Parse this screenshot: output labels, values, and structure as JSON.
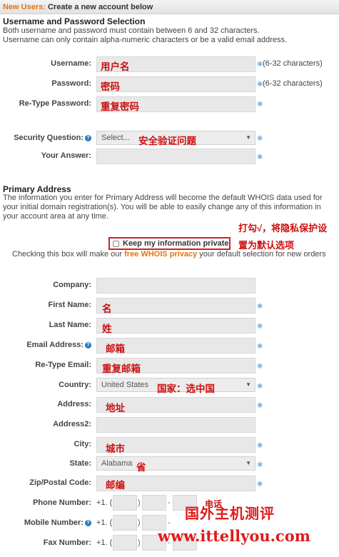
{
  "header": {
    "highlight": "New Users:",
    "title": "Create a new account below"
  },
  "account": {
    "title": "Username and Password Selection",
    "desc1": "Both username and password must contain between 6 and 32 characters.",
    "desc2": "Username can only contain alpha-numeric characters or be a valid email address.",
    "username_label": "Username:",
    "username_value": "用户名",
    "username_hint": "(6-32 characters)",
    "password_label": "Password:",
    "password_value": "密码",
    "password_hint": "(6-32 characters)",
    "retype_label": "Re-Type Password:",
    "retype_value": "重复密码",
    "question_label": "Security Question:",
    "question_value": "Select...",
    "question_note": "安全验证问题",
    "answer_label": "Your Answer:"
  },
  "primary": {
    "title": "Primary Address",
    "desc": "The information you enter for Primary Address will become the default WHOIS data used for your initial domain registration(s). You will be able to easily change any of this information in your account area at any time.",
    "privacy_label": "Keep my information private",
    "privacy_note1": "打勾√，将隐私保护设",
    "privacy_note2": "置为默认选项",
    "privacy_desc_before": "Checking this box will make our ",
    "privacy_desc_link": "free WHOIS privacy",
    "privacy_desc_after": " your default selection for new orders"
  },
  "form": {
    "company_label": "Company:",
    "first_label": "First Name:",
    "first_value": "名",
    "last_label": "Last Name:",
    "last_value": "姓",
    "email_label": "Email Address:",
    "email_value": "邮箱",
    "retype_email_label": "Re-Type Email:",
    "retype_email_value": "重复邮箱",
    "country_label": "Country:",
    "country_value": "United States",
    "country_note": "国家：选中国",
    "address_label": "Address:",
    "address_value": "地址",
    "address2_label": "Address2:",
    "city_label": "City:",
    "city_value": "城市",
    "state_label": "State:",
    "state_value": "Alabama",
    "state_note": "省",
    "zip_label": "Zip/Postal Code:",
    "zip_value": "邮编",
    "phone_label": "Phone Number:",
    "phone_prefix": "+1. (",
    "phone_note": "电话",
    "mobile_label": "Mobile Number:",
    "mobile_prefix": "+1. (",
    "fax_label": "Fax Number:",
    "fax_prefix": "+1. (",
    "phone_sep_paren": ")",
    "phone_sep_dash": "-"
  },
  "watermark": {
    "line1": "国外主机测评",
    "line2": "www.ittellyou.com"
  },
  "colors": {
    "accent": "#e2730f",
    "annotation": "#cc1111",
    "required_star": "#7ab6e8",
    "link": "#e2730f"
  },
  "icons": {
    "help": "question-circle-icon",
    "dropdown": "chevron-down-icon",
    "required": "asterisk-icon"
  }
}
